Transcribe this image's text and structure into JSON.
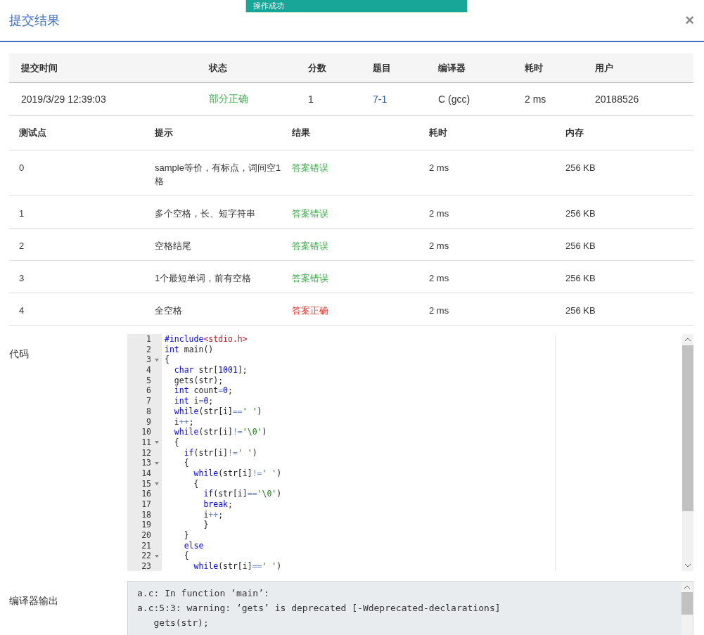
{
  "toast": {
    "text": "操作成功"
  },
  "dialog": {
    "title": "提交结果",
    "close": "×"
  },
  "summary": {
    "columns": [
      "提交时间",
      "状态",
      "分数",
      "题目",
      "编译器",
      "耗时",
      "用户"
    ],
    "row": {
      "time": "2019/3/29 12:39:03",
      "status": {
        "text": "部分正确",
        "kind": "partial"
      },
      "score": "1",
      "problem": "7-1",
      "compiler": "C (gcc)",
      "duration": "2 ms",
      "user": "20188526"
    }
  },
  "tests": {
    "columns": [
      "测试点",
      "提示",
      "结果",
      "耗时",
      "内存"
    ],
    "rows": [
      {
        "id": "0",
        "hint": "sample等价，有标点，词间空1格",
        "result": {
          "text": "答案错误",
          "kind": "wrong"
        },
        "time": "2 ms",
        "memory": "256 KB"
      },
      {
        "id": "1",
        "hint": "多个空格，长、短字符串",
        "result": {
          "text": "答案错误",
          "kind": "wrong"
        },
        "time": "2 ms",
        "memory": "256 KB"
      },
      {
        "id": "2",
        "hint": "空格结尾",
        "result": {
          "text": "答案错误",
          "kind": "wrong"
        },
        "time": "2 ms",
        "memory": "256 KB"
      },
      {
        "id": "3",
        "hint": "1个最短单词，前有空格",
        "result": {
          "text": "答案错误",
          "kind": "wrong"
        },
        "time": "2 ms",
        "memory": "256 KB"
      },
      {
        "id": "4",
        "hint": "全空格",
        "result": {
          "text": "答案正确",
          "kind": "correct"
        },
        "time": "2 ms",
        "memory": "256 KB"
      }
    ]
  },
  "code": {
    "label": "代码",
    "lines": [
      {
        "no": "1",
        "fold": false,
        "tokens": [
          {
            "kind": "kw",
            "text": "#include"
          },
          {
            "kind": "inc",
            "text": "<stdio.h>"
          }
        ]
      },
      {
        "no": "2",
        "fold": false,
        "tokens": [
          {
            "kind": "kw",
            "text": "int"
          },
          {
            "kind": "plain",
            "text": " main()"
          }
        ]
      },
      {
        "no": "3",
        "fold": true,
        "tokens": [
          {
            "kind": "plain",
            "text": "{"
          }
        ]
      },
      {
        "no": "4",
        "fold": false,
        "tokens": [
          {
            "kind": "kw",
            "text": "  char"
          },
          {
            "kind": "plain",
            "text": " str["
          },
          {
            "kind": "num",
            "text": "1001"
          },
          {
            "kind": "plain",
            "text": "];"
          }
        ]
      },
      {
        "no": "5",
        "fold": false,
        "tokens": [
          {
            "kind": "plain",
            "text": "  gets(str);"
          }
        ]
      },
      {
        "no": "6",
        "fold": false,
        "tokens": [
          {
            "kind": "kw",
            "text": "  int"
          },
          {
            "kind": "plain",
            "text": " count"
          },
          {
            "kind": "op",
            "text": "="
          },
          {
            "kind": "num",
            "text": "0"
          },
          {
            "kind": "plain",
            "text": ";"
          }
        ]
      },
      {
        "no": "7",
        "fold": false,
        "tokens": [
          {
            "kind": "kw",
            "text": "  int"
          },
          {
            "kind": "plain",
            "text": " i"
          },
          {
            "kind": "op",
            "text": "="
          },
          {
            "kind": "num",
            "text": "0"
          },
          {
            "kind": "plain",
            "text": ";"
          }
        ]
      },
      {
        "no": "8",
        "fold": false,
        "tokens": [
          {
            "kind": "kw",
            "text": "  while"
          },
          {
            "kind": "plain",
            "text": "(str[i]"
          },
          {
            "kind": "op",
            "text": "=="
          },
          {
            "kind": "str",
            "text": "' '"
          },
          {
            "kind": "plain",
            "text": ")"
          }
        ]
      },
      {
        "no": "9",
        "fold": false,
        "tokens": [
          {
            "kind": "plain",
            "text": "  i"
          },
          {
            "kind": "op",
            "text": "++"
          },
          {
            "kind": "plain",
            "text": ";"
          }
        ]
      },
      {
        "no": "10",
        "fold": false,
        "tokens": [
          {
            "kind": "kw",
            "text": "  while"
          },
          {
            "kind": "plain",
            "text": "(str[i]"
          },
          {
            "kind": "op",
            "text": "!="
          },
          {
            "kind": "str",
            "text": "'\\0'"
          },
          {
            "kind": "plain",
            "text": ")"
          }
        ]
      },
      {
        "no": "11",
        "fold": true,
        "tokens": [
          {
            "kind": "plain",
            "text": "  {"
          }
        ]
      },
      {
        "no": "12",
        "fold": false,
        "tokens": [
          {
            "kind": "kw",
            "text": "    if"
          },
          {
            "kind": "plain",
            "text": "(str[i]"
          },
          {
            "kind": "op",
            "text": "!="
          },
          {
            "kind": "str",
            "text": "' '"
          },
          {
            "kind": "plain",
            "text": ")"
          }
        ]
      },
      {
        "no": "13",
        "fold": true,
        "tokens": [
          {
            "kind": "plain",
            "text": "    {"
          }
        ]
      },
      {
        "no": "14",
        "fold": false,
        "tokens": [
          {
            "kind": "kw",
            "text": "      while"
          },
          {
            "kind": "plain",
            "text": "(str[i]"
          },
          {
            "kind": "op",
            "text": "!="
          },
          {
            "kind": "str",
            "text": "' '"
          },
          {
            "kind": "plain",
            "text": ")"
          }
        ]
      },
      {
        "no": "15",
        "fold": true,
        "tokens": [
          {
            "kind": "plain",
            "text": "      {"
          }
        ]
      },
      {
        "no": "16",
        "fold": false,
        "tokens": [
          {
            "kind": "kw",
            "text": "        if"
          },
          {
            "kind": "plain",
            "text": "(str[i]"
          },
          {
            "kind": "op",
            "text": "=="
          },
          {
            "kind": "str",
            "text": "'\\0'"
          },
          {
            "kind": "plain",
            "text": ")"
          }
        ]
      },
      {
        "no": "17",
        "fold": false,
        "tokens": [
          {
            "kind": "kw",
            "text": "        break"
          },
          {
            "kind": "plain",
            "text": ";"
          }
        ]
      },
      {
        "no": "18",
        "fold": false,
        "tokens": [
          {
            "kind": "plain",
            "text": "        i"
          },
          {
            "kind": "op",
            "text": "++"
          },
          {
            "kind": "plain",
            "text": ";"
          }
        ]
      },
      {
        "no": "19",
        "fold": false,
        "tokens": [
          {
            "kind": "plain",
            "text": "        }"
          }
        ]
      },
      {
        "no": "20",
        "fold": false,
        "tokens": [
          {
            "kind": "plain",
            "text": "    }"
          }
        ]
      },
      {
        "no": "21",
        "fold": false,
        "tokens": [
          {
            "kind": "kw",
            "text": "    else"
          }
        ]
      },
      {
        "no": "22",
        "fold": true,
        "tokens": [
          {
            "kind": "plain",
            "text": "    {"
          }
        ]
      },
      {
        "no": "23",
        "fold": false,
        "tokens": [
          {
            "kind": "kw",
            "text": "      while"
          },
          {
            "kind": "plain",
            "text": "(str[i]"
          },
          {
            "kind": "op",
            "text": "=="
          },
          {
            "kind": "str",
            "text": "' '"
          },
          {
            "kind": "plain",
            "text": ")"
          }
        ]
      }
    ]
  },
  "compiler_output": {
    "label": "编译器输出",
    "lines": [
      "a.c: In function ‘main’:",
      "a.c:5:3: warning: ‘gets’ is deprecated [-Wdeprecated-declarations]",
      "   gets(str);"
    ]
  }
}
